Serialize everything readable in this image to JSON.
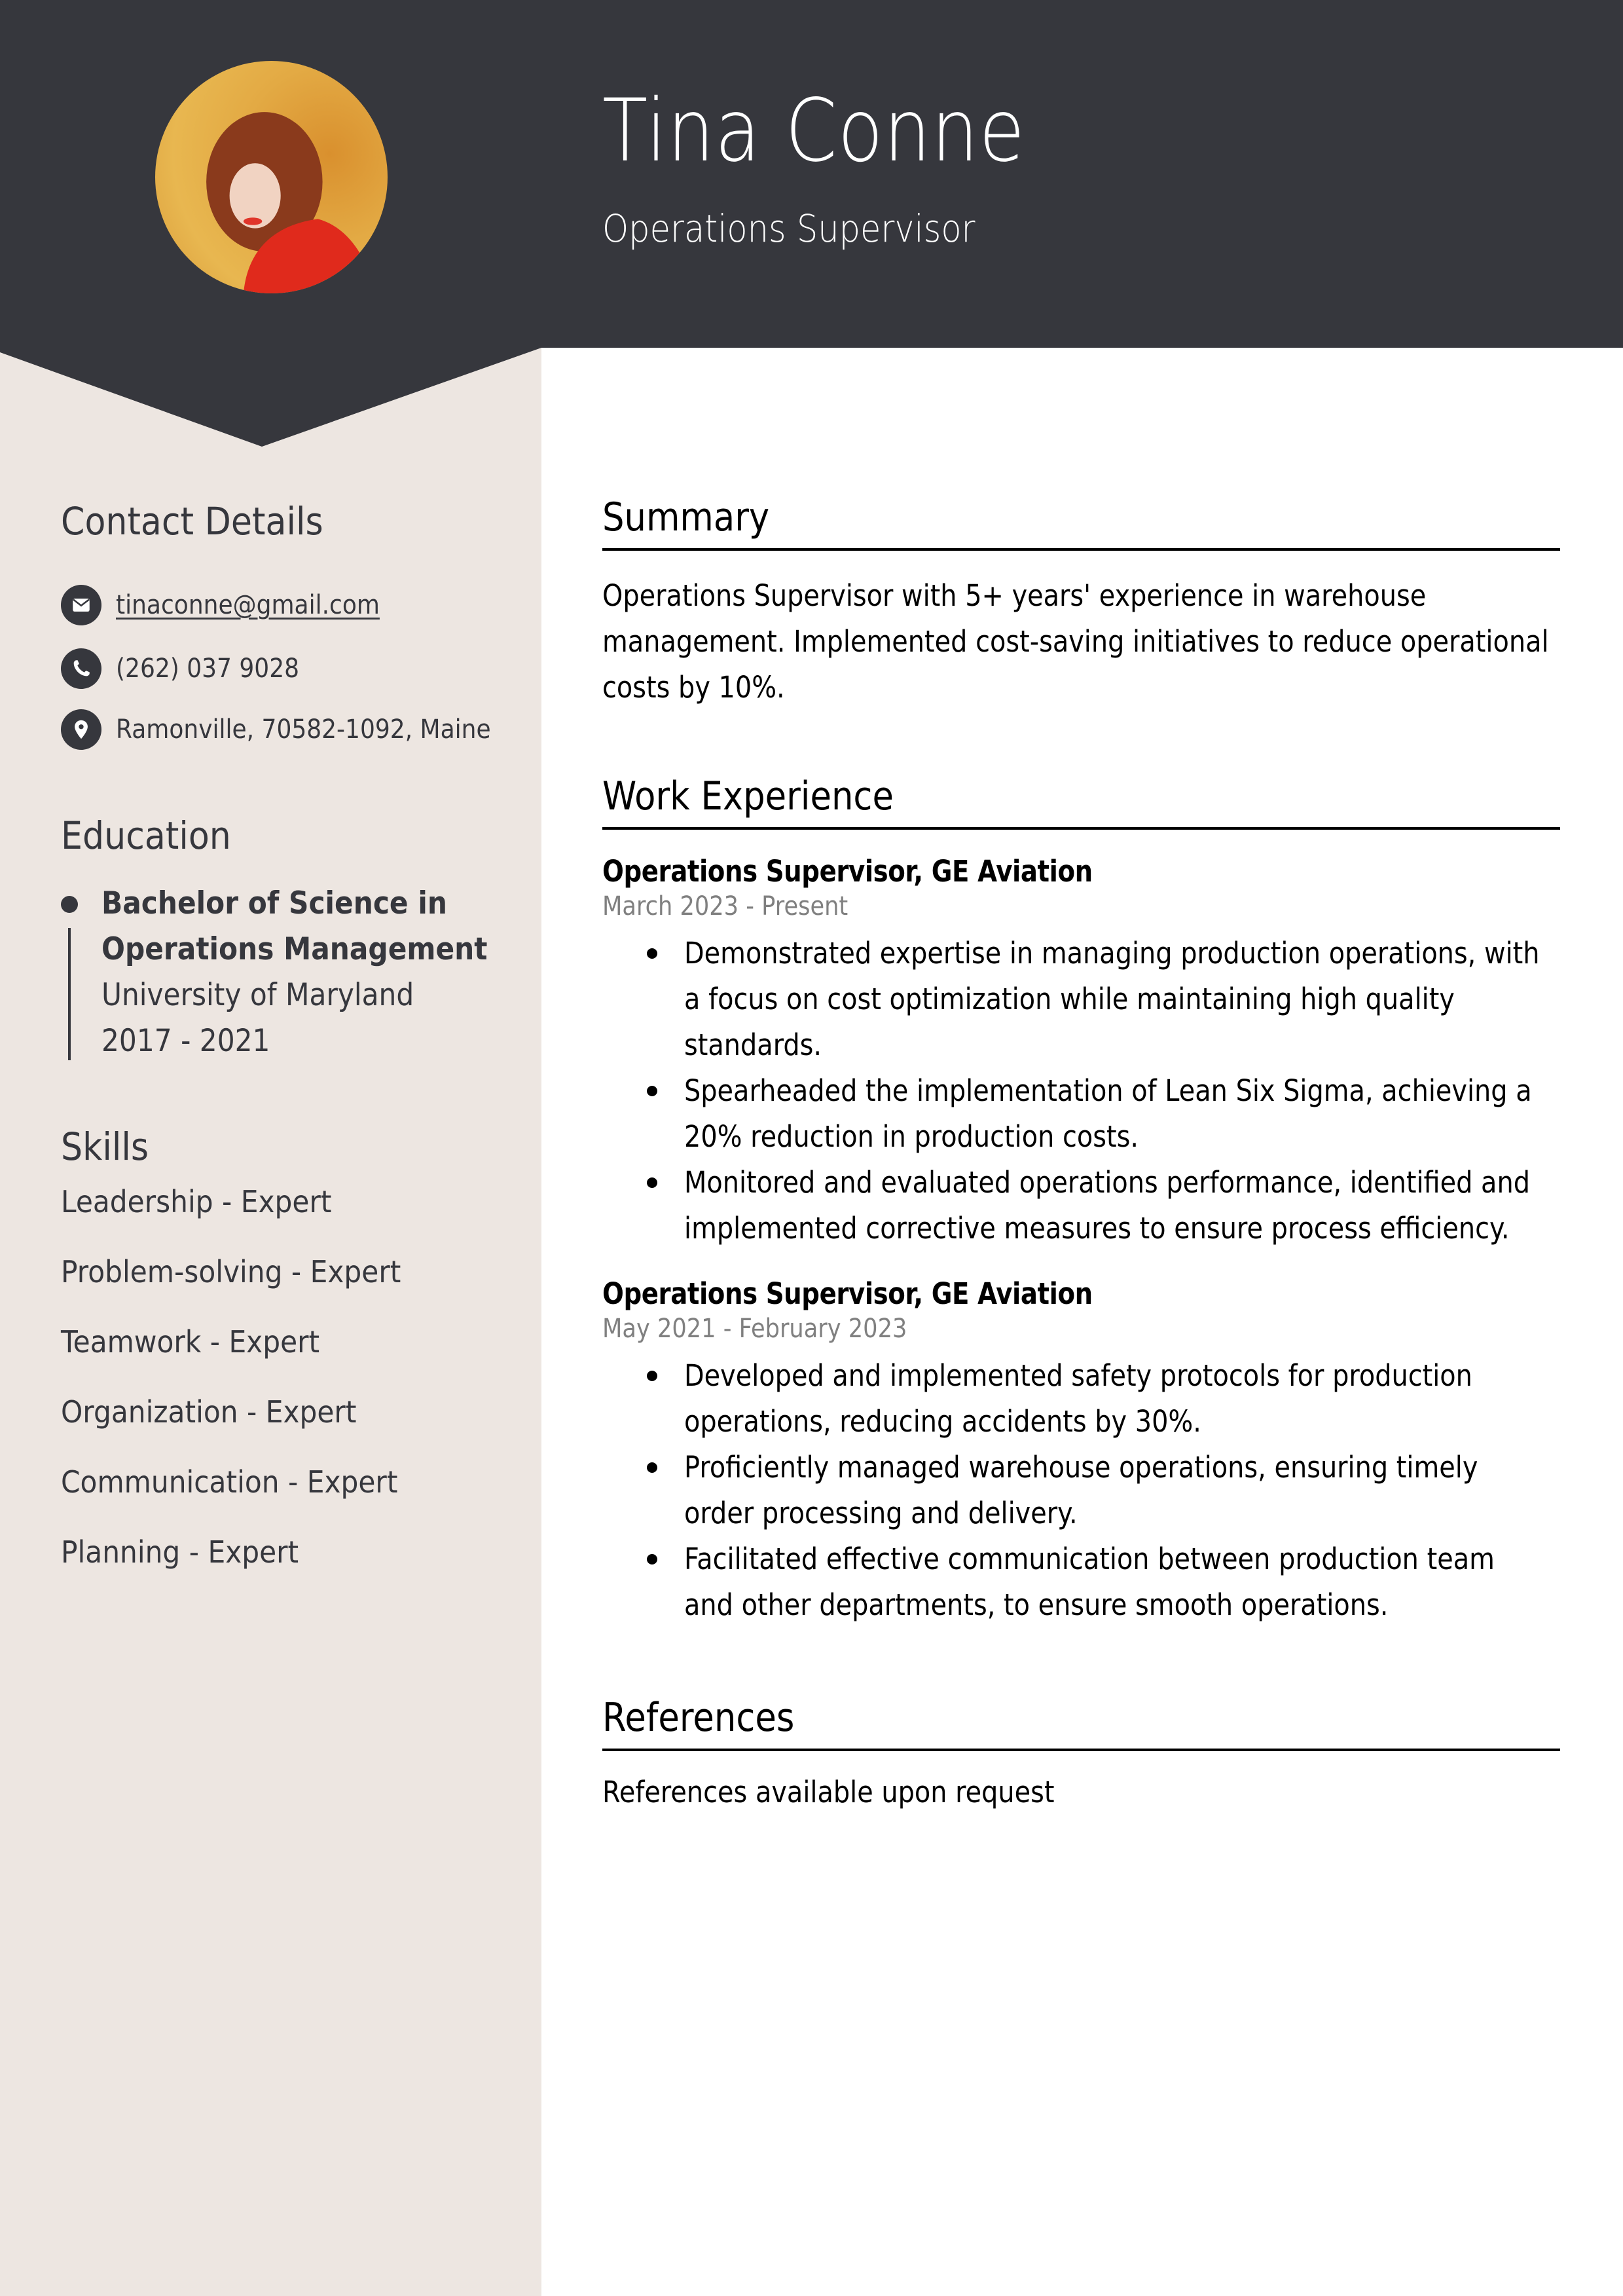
{
  "header": {
    "name": "Tina Conne",
    "title": "Operations Supervisor",
    "avatar_alt": "profile-photo",
    "band_color": "#36373d",
    "sidebar_color": "#ede6e1"
  },
  "sidebar": {
    "contact": {
      "heading": "Contact Details",
      "items": [
        {
          "icon": "envelope-icon",
          "text": "tinaconne@gmail.com",
          "is_link": true
        },
        {
          "icon": "phone-icon",
          "text": "(262) 037 9028",
          "is_link": false
        },
        {
          "icon": "location-pin-icon",
          "text": "Ramonville, 70582-1092, Maine",
          "is_link": false
        }
      ]
    },
    "education": {
      "heading": "Education",
      "entries": [
        {
          "degree_line1": "Bachelor of Science in",
          "degree_line2": "Operations Management",
          "school": "University of Maryland",
          "years": "2017 - 2021"
        }
      ]
    },
    "skills": {
      "heading": "Skills",
      "items": [
        "Leadership - Expert",
        "Problem-solving - Expert",
        "Teamwork - Expert",
        "Organization - Expert",
        "Communication - Expert",
        "Planning - Expert"
      ]
    }
  },
  "main": {
    "summary": {
      "heading": "Summary",
      "lines": [
        "Operations Supervisor with 5+ years' experience in warehouse",
        "management. Implemented cost-saving initiatives to reduce operational",
        "costs by 10%."
      ]
    },
    "experience": {
      "heading": "Work Experience",
      "jobs": [
        {
          "title": "Operations Supervisor, GE Aviation",
          "dates": "March 2023 - Present",
          "bullets": [
            [
              "Demonstrated expertise in managing production operations, with",
              "a focus on cost optimization while maintaining high quality",
              "standards."
            ],
            [
              "Spearheaded the implementation of Lean Six Sigma, achieving a",
              "20% reduction in production costs."
            ],
            [
              "Monitored and evaluated operations performance, identified and",
              "implemented corrective measures to ensure process efficiency."
            ]
          ]
        },
        {
          "title": "Operations Supervisor, GE Aviation",
          "dates": "May 2021 - February 2023",
          "bullets": [
            [
              "Developed and implemented safety protocols for production",
              "operations, reducing accidents by 30%."
            ],
            [
              "Proficiently managed warehouse operations, ensuring timely",
              "order processing and delivery."
            ],
            [
              "Facilitated effective communication between production team",
              "and other departments, to ensure smooth operations."
            ]
          ]
        }
      ]
    },
    "references": {
      "heading": "References",
      "text": "References available upon request"
    }
  }
}
